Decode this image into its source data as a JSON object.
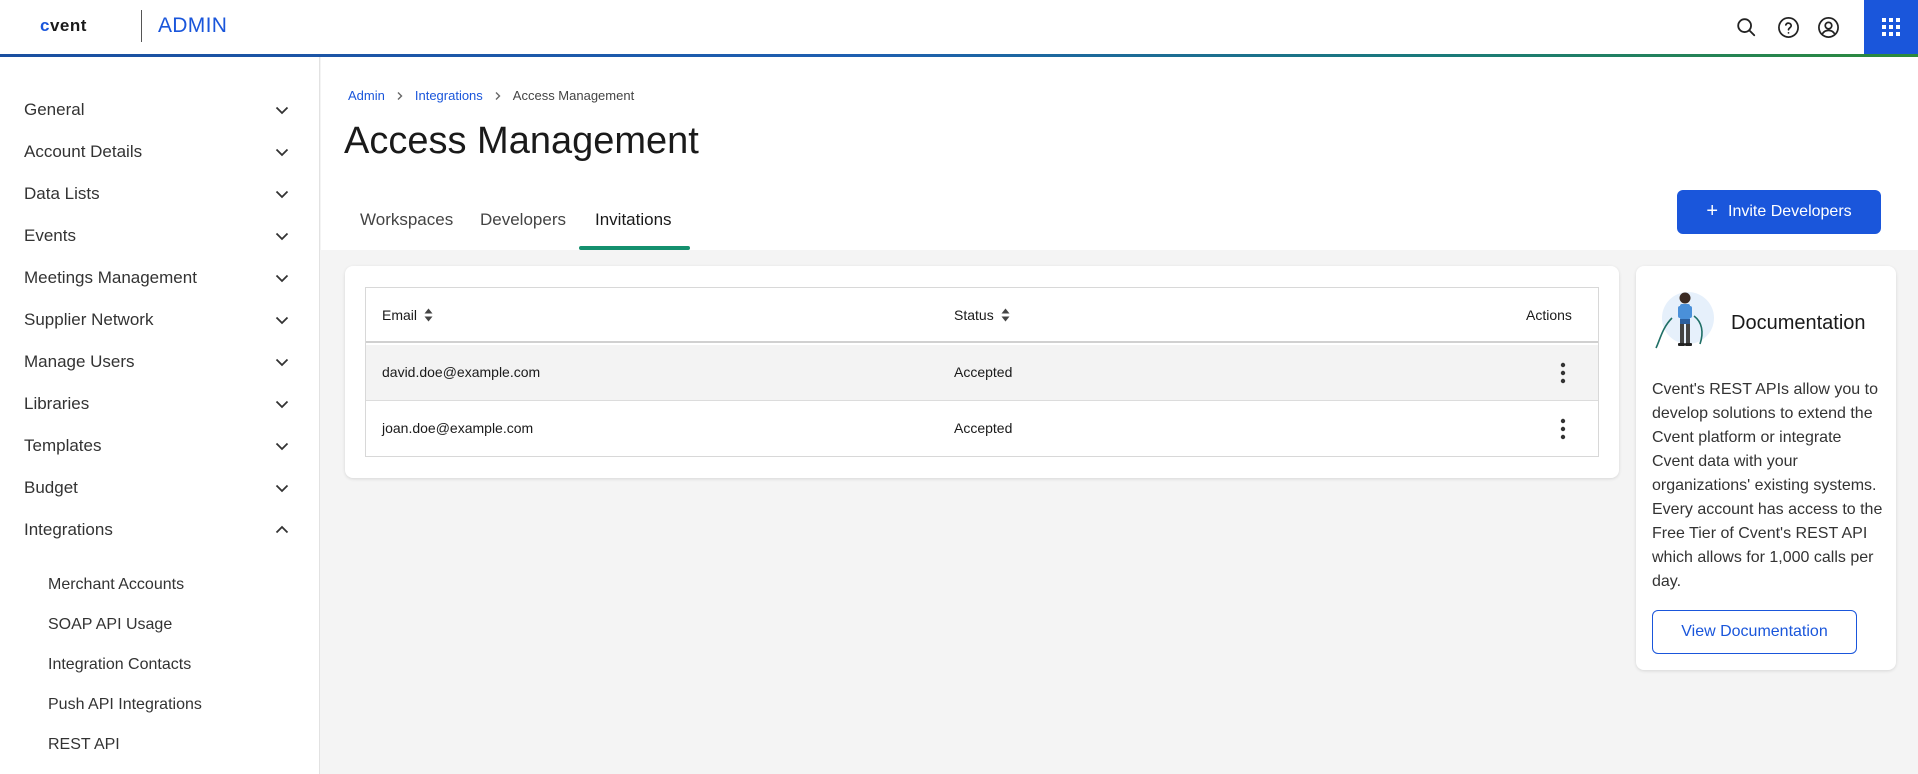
{
  "header": {
    "logo_text": "cvent",
    "app_name": "ADMIN",
    "icons": [
      "search-icon",
      "help-icon",
      "account-icon",
      "apps-grid-icon"
    ],
    "accent_color": "#1a56db"
  },
  "sidebar": {
    "items": [
      {
        "label": "General",
        "expanded": false
      },
      {
        "label": "Account Details",
        "expanded": false
      },
      {
        "label": "Data Lists",
        "expanded": false
      },
      {
        "label": "Events",
        "expanded": false
      },
      {
        "label": "Meetings Management",
        "expanded": false
      },
      {
        "label": "Supplier Network",
        "expanded": false
      },
      {
        "label": "Manage Users",
        "expanded": false
      },
      {
        "label": "Libraries",
        "expanded": false
      },
      {
        "label": "Templates",
        "expanded": false
      },
      {
        "label": "Budget",
        "expanded": false
      },
      {
        "label": "Integrations",
        "expanded": true
      }
    ],
    "sub_items": [
      "Merchant Accounts",
      "SOAP API Usage",
      "Integration Contacts",
      "Push API Integrations",
      "REST API"
    ]
  },
  "breadcrumb": {
    "items": [
      "Admin",
      "Integrations"
    ],
    "current": "Access Management"
  },
  "page": {
    "title": "Access Management",
    "tabs": [
      {
        "label": "Workspaces",
        "active": false
      },
      {
        "label": "Developers",
        "active": false
      },
      {
        "label": "Invitations",
        "active": true
      }
    ],
    "invite_button": "Invite Developers",
    "active_tab_color": "#14906e"
  },
  "table": {
    "columns": {
      "email": "Email",
      "status": "Status",
      "actions": "Actions"
    },
    "rows": [
      {
        "email": "david.doe@example.com",
        "status": "Accepted"
      },
      {
        "email": "joan.doe@example.com",
        "status": "Accepted"
      }
    ]
  },
  "documentation": {
    "title": "Documentation",
    "text": "Cvent's REST APIs allow you to develop solutions to extend the Cvent platform or integrate Cvent data with your organizations' existing systems. Every account has access to the Free Tier of Cvent's REST API which allows for 1,000 calls per day.",
    "button": "View Documentation"
  }
}
